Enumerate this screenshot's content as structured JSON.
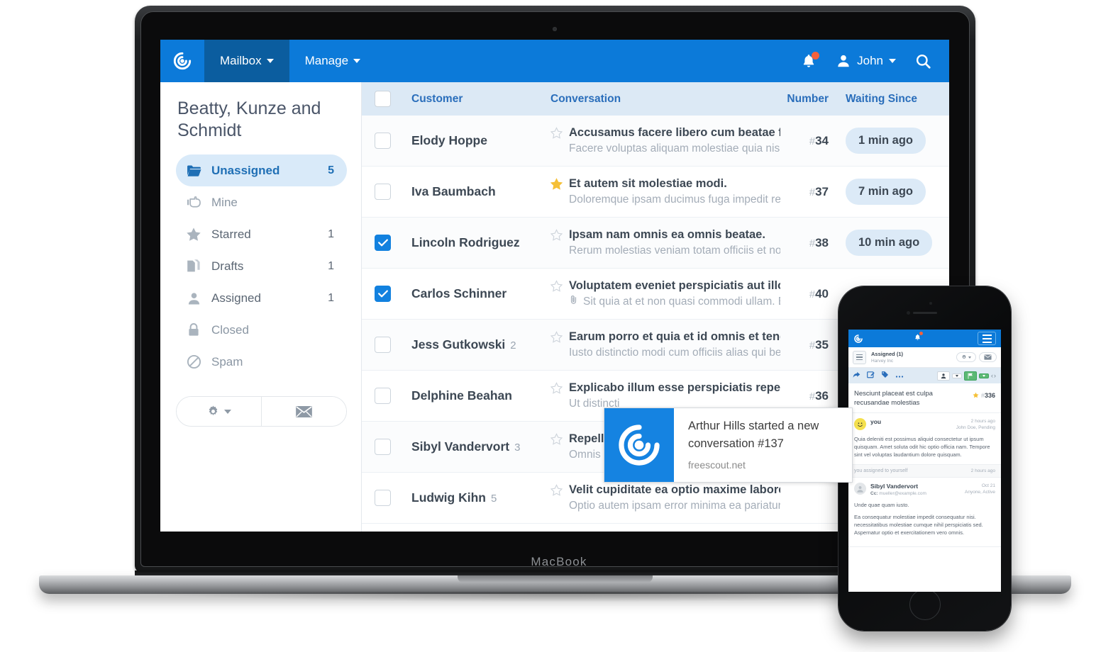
{
  "device": {
    "laptop_label": "MacBook"
  },
  "navbar": {
    "logo_icon": "freescout-spiral-logo-icon",
    "items": [
      {
        "label": "Mailbox",
        "active": true,
        "icon": "caret-down-icon"
      },
      {
        "label": "Manage",
        "active": false,
        "icon": "caret-down-icon"
      }
    ],
    "notification_icon": "bell-icon",
    "notification_badge": true,
    "user_icon": "user-icon",
    "user_name": "John",
    "user_caret": "caret-down-icon",
    "search_icon": "search-icon"
  },
  "sidebar": {
    "mailbox_title": "Beatty, Kunze and Schmidt",
    "folders": [
      {
        "label": "Unassigned",
        "count": "5",
        "icon": "folder-icon",
        "active": true
      },
      {
        "label": "Mine",
        "count": "",
        "icon": "hand-pointer-icon",
        "active": false
      },
      {
        "label": "Starred",
        "count": "1",
        "icon": "star-icon",
        "active": false
      },
      {
        "label": "Drafts",
        "count": "1",
        "icon": "drafts-icon",
        "active": false
      },
      {
        "label": "Assigned",
        "count": "1",
        "icon": "user-icon",
        "active": false
      },
      {
        "label": "Closed",
        "count": "",
        "icon": "lock-icon",
        "active": false
      },
      {
        "label": "Spam",
        "count": "",
        "icon": "ban-icon",
        "active": false
      }
    ],
    "buttons": [
      {
        "name": "settings",
        "icon": "gear-icon",
        "caret": "caret-down-icon"
      },
      {
        "name": "new-conversation",
        "icon": "envelope-icon"
      }
    ]
  },
  "table": {
    "headers": {
      "select_all": "select-all-checkbox",
      "customer": "Customer",
      "conversation": "Conversation",
      "number": "Number",
      "waiting_since": "Waiting Since"
    },
    "rows": [
      {
        "checked": false,
        "customer": "Elody Hoppe",
        "thread_count": "",
        "starred": false,
        "attachment": false,
        "subject": "Accusamus facere libero cum beatae fugit a",
        "preview": "Facere voluptas aliquam molestiae quia nisi offi",
        "number": "34",
        "waiting": "1 min ago"
      },
      {
        "checked": false,
        "customer": "Iva Baumbach",
        "thread_count": "",
        "starred": true,
        "attachment": false,
        "subject": "Et autem sit molestiae modi.",
        "preview": "Doloremque ipsam ducimus fuga impedit rem.",
        "number": "37",
        "waiting": "7 min ago"
      },
      {
        "checked": true,
        "customer": "Lincoln Rodriguez",
        "thread_count": "",
        "starred": false,
        "attachment": false,
        "subject": "Ipsam nam omnis ea omnis beatae.",
        "preview": "Rerum molestias veniam totam officiis et non.",
        "number": "38",
        "waiting": "10 min ago"
      },
      {
        "checked": true,
        "customer": "Carlos Schinner",
        "thread_count": "",
        "starred": false,
        "attachment": true,
        "subject": "Voluptatem eveniet perspiciatis aut illo iste",
        "preview": "Sit quia at et non quasi commodi ullam. Et perfe",
        "number": "40",
        "waiting": ""
      },
      {
        "checked": false,
        "customer": "Jess Gutkowski",
        "thread_count": "2",
        "starred": false,
        "attachment": false,
        "subject": "Earum porro et quia et id omnis et tenetur vo",
        "preview": "Iusto distinctio modi cum officiis alias qui beata",
        "number": "35",
        "waiting": ""
      },
      {
        "checked": false,
        "customer": "Delphine Beahan",
        "thread_count": "",
        "starred": false,
        "attachment": false,
        "subject": "Explicabo illum esse perspiciatis repellat no",
        "preview": "Ut distincti",
        "number": "36",
        "waiting": ""
      },
      {
        "checked": false,
        "customer": "Sibyl Vandervort",
        "thread_count": "3",
        "starred": false,
        "attachment": false,
        "subject": "Repellend",
        "preview": "Omnis quo",
        "number": "",
        "waiting": ""
      },
      {
        "checked": false,
        "customer": "Ludwig Kihn",
        "thread_count": "5",
        "starred": false,
        "attachment": false,
        "subject": "Velit cupiditate ea optio maxime labore error be",
        "preview": "Optio autem ipsam error minima ea pariatur iste",
        "number": "",
        "waiting": ""
      }
    ]
  },
  "toast": {
    "icon": "freescout-spiral-logo-icon",
    "title": "Arthur Hills started a new conversation #137",
    "source": "freescout.net"
  },
  "phone": {
    "navbar": {
      "logo_icon": "freescout-spiral-logo-icon",
      "bell_icon": "bell-icon",
      "menu_icon": "hamburger-icon"
    },
    "subheader": {
      "menu_icon": "hamburger-icon",
      "folder": "Assigned (1)",
      "mailbox": "Harvey Inc",
      "settings_icon": "gear-icon",
      "settings_caret": "caret-down-icon",
      "compose_icon": "envelope-icon"
    },
    "toolbar": {
      "icons": [
        "reply-arrow-icon",
        "edit-icon",
        "tag-icon",
        "ellipsis-icon"
      ],
      "assignee_icon": "user-icon",
      "assignee_caret": "caret-down-icon",
      "status_icon": "flag-icon",
      "status_caret": "caret-down-icon",
      "prev_icon": "chevron-left-icon",
      "next_icon": "chevron-right-icon"
    },
    "conversation": {
      "subject": "Nesciunt placeat est culpa recusandae molestias",
      "starred": true,
      "number": "336"
    },
    "threads": [
      {
        "type": "message",
        "avatar": "smiley-avatar",
        "author": "you",
        "cc": "",
        "when": "2 hours ago",
        "state": "John Doe, Pending",
        "body": "Quia deleniti est possimus aliquid consectetur ut ipsum quisquam. Amet soluta odit hic optio officia nam. Tempore sint vel voluptas laudantium dolore quisquam."
      },
      {
        "type": "note",
        "text": "you assigned to yourself",
        "when": "2 hours ago"
      },
      {
        "type": "message",
        "avatar": "person-avatar",
        "author": "Sibyl Vandervort",
        "cc_label": "Cc:",
        "cc": "mueller@example.com",
        "when": "Oct 21",
        "state": "Anyone, Active",
        "body1": "Unde quae quam iusto.",
        "body2": "Ea consequatur molestiae impedit consequatur nisi. necessitatibus molestiae cumque nihil perspiciatis sed. Aspernatur optio et exercitationem vero omnis."
      }
    ]
  },
  "colors": {
    "brand_blue": "#0c7ad9",
    "active_nav": "#0b5d9f",
    "header_blue": "#dce9f5",
    "star_gold": "#f5c037",
    "badge_orange": "#f5613c",
    "green": "#5cb974"
  }
}
